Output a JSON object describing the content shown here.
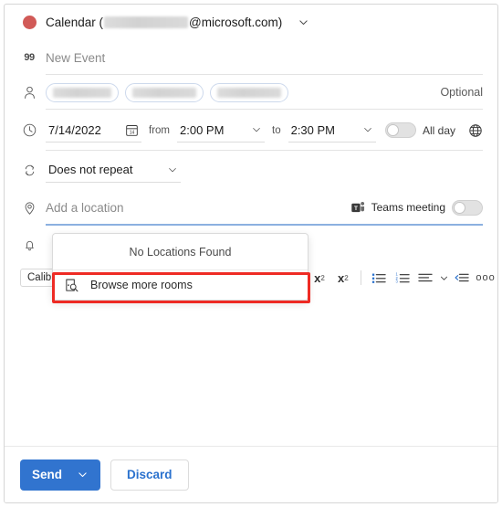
{
  "window": {
    "accent_color": "#3174cf",
    "highlight_color": "#ee2b24",
    "calendar_dot_color": "#d15a57"
  },
  "header": {
    "calendar_prefix": "Calendar (",
    "calendar_domain": "@microsoft.com)",
    "chevron_icon": "chevron-down-icon",
    "dot_icon": "calendar-color-dot"
  },
  "title": {
    "icon": "quote-icon",
    "icon_glyph": "99",
    "placeholder": "New Event",
    "value": ""
  },
  "attendees": {
    "icon": "person-icon",
    "pill_count": 3,
    "optional_label": "Optional"
  },
  "datetime": {
    "icon": "clock-icon",
    "date": "7/14/2022",
    "date_picker_icon": "calendar-picker-icon",
    "date_picker_day": "14",
    "from_label": "from",
    "start_time": "2:00 PM",
    "to_label": "to",
    "end_time": "2:30 PM",
    "all_day_label": "All day",
    "all_day_on": false,
    "timezone_icon": "globe-icon"
  },
  "repeat": {
    "icon": "repeat-icon",
    "value": "Does not repeat"
  },
  "location": {
    "icon": "location-pin-icon",
    "placeholder": "Add a location",
    "value": "",
    "teams_icon": "teams-icon",
    "teams_label": "Teams meeting",
    "teams_on": false
  },
  "reminder": {
    "icon": "bell-icon"
  },
  "location_dropdown": {
    "empty_message": "No Locations Found",
    "browse_item": {
      "label": "Browse more rooms",
      "icon": "room-search-icon"
    }
  },
  "format_toolbar": {
    "font_name": "Calibri",
    "items": [
      {
        "name": "superscript-icon",
        "label": "x"
      },
      {
        "name": "subscript-icon",
        "label": "x"
      },
      {
        "name": "bulleted-list-icon",
        "label": ""
      },
      {
        "name": "numbered-list-icon",
        "label": ""
      },
      {
        "name": "align-icon",
        "label": ""
      },
      {
        "name": "align-chevron-icon",
        "label": ""
      },
      {
        "name": "indent-icon",
        "label": ""
      },
      {
        "name": "more-options-icon",
        "label": "ooo"
      }
    ]
  },
  "footer": {
    "send_label": "Send",
    "send_chevron_icon": "chevron-down-icon",
    "discard_label": "Discard"
  }
}
